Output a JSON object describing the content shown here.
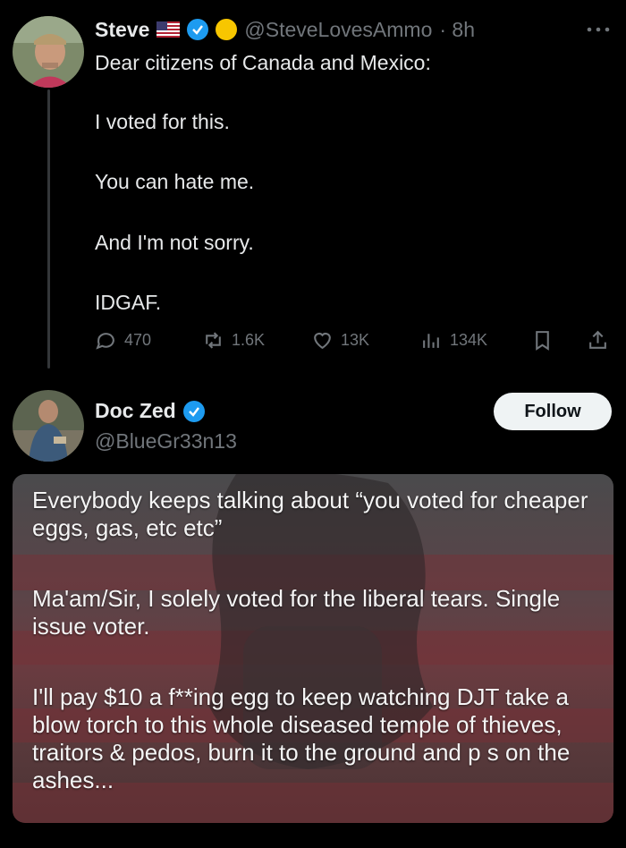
{
  "tweet1": {
    "name": "Steve",
    "handle": "@SteveLovesAmmo",
    "time": "· 8h",
    "more_icon": "more-dots-icon",
    "lines": [
      "Dear citizens of Canada and Mexico:",
      "I voted for this.",
      "You can hate me.",
      "And I'm not sorry.",
      "IDGAF."
    ],
    "actions": {
      "replies": "470",
      "retweets": "1.6K",
      "likes": "13K",
      "views": "134K"
    }
  },
  "tweet2": {
    "name": "Doc Zed",
    "handle": "@BlueGr33n13",
    "follow_label": "Follow",
    "media_text": {
      "p1": "Everybody keeps talking about “you voted for cheaper eggs, gas, etc etc”",
      "p2": "Ma'am/Sir, I solely voted for the liberal tears. Single issue voter.",
      "p3": "I'll pay $10 a f**ing egg to keep watching DJT take a blow torch to this whole diseased temple of thieves, traitors & pedos, burn it to the ground and p   s on the ashes..."
    }
  },
  "colors": {
    "background": "#000000",
    "text": "#e7e9ea",
    "muted": "#71767b",
    "verified": "#1d9bf0",
    "follow_bg": "#eff3f4"
  }
}
